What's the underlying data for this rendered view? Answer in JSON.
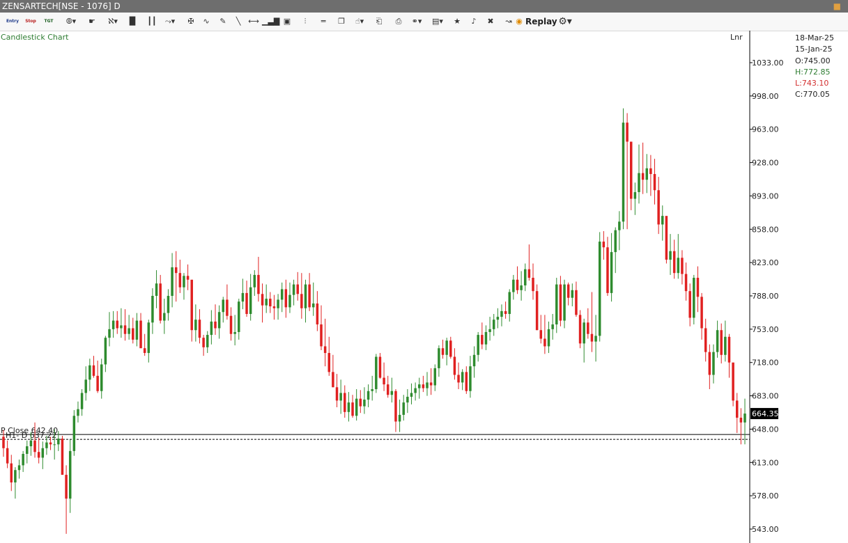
{
  "window": {
    "title": "ZENSARTECH[NSE - 1076] D",
    "close_glyph": "💰"
  },
  "toolbar": {
    "items": [
      {
        "name": "entry-tool",
        "label": "Entry",
        "kind": "small",
        "color": "#1e3a8a"
      },
      {
        "name": "stop-tool",
        "label": "Stop",
        "kind": "small",
        "color": "#b71c1c"
      },
      {
        "name": "target-tool",
        "label": "TGT",
        "kind": "small",
        "color": "#1b5e20"
      },
      {
        "name": "indicator-icon",
        "label": "⦾▾"
      },
      {
        "name": "cursor-icon",
        "label": "☛"
      },
      {
        "name": "study-icon",
        "label": "ℵ▾"
      },
      {
        "name": "bar-chart-icon",
        "label": "▐▌"
      },
      {
        "name": "candle-chart-icon",
        "label": "┃┃"
      },
      {
        "name": "pattern-icon",
        "label": "⤳▾"
      },
      {
        "name": "crosshair-icon",
        "label": "✠"
      },
      {
        "name": "wave-icon",
        "label": "∿"
      },
      {
        "name": "pencil-icon",
        "label": "✎"
      },
      {
        "name": "trendline-icon",
        "label": "╲"
      },
      {
        "name": "horizontal-line-icon",
        "label": "⟷"
      },
      {
        "name": "volume-icon",
        "label": "▁▃▇"
      },
      {
        "name": "box-icon",
        "label": "▣"
      },
      {
        "name": "fib-icon",
        "label": "⫶"
      },
      {
        "name": "equal-lines-icon",
        "label": "═"
      },
      {
        "name": "tag-icon",
        "label": "❐"
      },
      {
        "name": "hand-icon",
        "label": "☝▾"
      },
      {
        "name": "doc-chart-icon",
        "label": "⎗"
      },
      {
        "name": "settings-doc-icon",
        "label": "⎙"
      },
      {
        "name": "link-icon",
        "label": "⚭▾"
      },
      {
        "name": "layout-icon",
        "label": "▤▾"
      },
      {
        "name": "star-icon",
        "label": "★"
      },
      {
        "name": "alert-icon",
        "label": "♪"
      },
      {
        "name": "delete-icon",
        "label": "✖"
      },
      {
        "name": "compare-icon",
        "label": "↝"
      }
    ],
    "replay_label": "Replay",
    "gear_glyph": "⚙▾"
  },
  "chart_data": {
    "type": "candlestick",
    "title": "Candlestick Chart",
    "scale_mode": "Lnr",
    "ylim": [
      533,
      1055
    ],
    "y_ticks": [
      "1033.00",
      "998.00",
      "963.00",
      "928.00",
      "893.00",
      "858.00",
      "823.00",
      "788.00",
      "753.00",
      "718.00",
      "683.00",
      "648.00",
      "613.00",
      "578.00",
      "543.00"
    ],
    "last_price": "664.35",
    "last_price_value": 664.35,
    "up_color": "#2e8b2e",
    "down_color": "#e02020",
    "info": {
      "date1": "18-Mar-25",
      "date2": "15-Jan-25",
      "open": "O:745.00",
      "high": "H:772.85",
      "low": "L:743.10",
      "close": "C:770.05"
    },
    "hlines": [
      {
        "label": "H1- D  637.22",
        "value": 637.22,
        "style": "dashed"
      },
      {
        "label": "P Close 642.40",
        "value": 642.4,
        "style": "solid"
      }
    ],
    "candles": [
      [
        640,
        647,
        619,
        628
      ],
      [
        628,
        636,
        607,
        612
      ],
      [
        612,
        621,
        583,
        592
      ],
      [
        592,
        608,
        575,
        605
      ],
      [
        605,
        616,
        596,
        610
      ],
      [
        610,
        625,
        603,
        622
      ],
      [
        622,
        636,
        612,
        630
      ],
      [
        630,
        645,
        620,
        636
      ],
      [
        636,
        655,
        618,
        624
      ],
      [
        624,
        639,
        612,
        618
      ],
      [
        618,
        635,
        606,
        628
      ],
      [
        628,
        641,
        621,
        634
      ],
      [
        634,
        640,
        626,
        632
      ],
      [
        632,
        648,
        616,
        632
      ],
      [
        632,
        646,
        625,
        638
      ],
      [
        638,
        641,
        600,
        600
      ],
      [
        600,
        610,
        538,
        575
      ],
      [
        575,
        637,
        560,
        625
      ],
      [
        625,
        668,
        620,
        662
      ],
      [
        662,
        677,
        655,
        669
      ],
      [
        669,
        690,
        662,
        686
      ],
      [
        686,
        714,
        678,
        700
      ],
      [
        700,
        722,
        688,
        715
      ],
      [
        715,
        725,
        702,
        704
      ],
      [
        704,
        720,
        686,
        688
      ],
      [
        688,
        722,
        680,
        716
      ],
      [
        716,
        746,
        708,
        744
      ],
      [
        744,
        771,
        735,
        753
      ],
      [
        753,
        772,
        744,
        762
      ],
      [
        762,
        772,
        748,
        754
      ],
      [
        754,
        775,
        744,
        757
      ],
      [
        757,
        774,
        741,
        748
      ],
      [
        748,
        768,
        742,
        754
      ],
      [
        754,
        765,
        738,
        742
      ],
      [
        742,
        770,
        735,
        762
      ],
      [
        762,
        770,
        734,
        733
      ],
      [
        733,
        748,
        725,
        728
      ],
      [
        728,
        763,
        718,
        760
      ],
      [
        760,
        796,
        748,
        788
      ],
      [
        788,
        815,
        775,
        801
      ],
      [
        801,
        810,
        759,
        762
      ],
      [
        762,
        785,
        748,
        770
      ],
      [
        770,
        795,
        762,
        788
      ],
      [
        788,
        833,
        776,
        818
      ],
      [
        818,
        835,
        782,
        812
      ],
      [
        812,
        826,
        791,
        797
      ],
      [
        797,
        812,
        784,
        809
      ],
      [
        809,
        821,
        794,
        805
      ],
      [
        805,
        768,
        740,
        752
      ],
      [
        752,
        779,
        740,
        763
      ],
      [
        763,
        774,
        738,
        744
      ],
      [
        744,
        747,
        725,
        734
      ],
      [
        734,
        751,
        728,
        747
      ],
      [
        747,
        773,
        737,
        761
      ],
      [
        761,
        779,
        747,
        754
      ],
      [
        754,
        778,
        743,
        771
      ],
      [
        771,
        787,
        760,
        784
      ],
      [
        784,
        800,
        763,
        767
      ],
      [
        767,
        776,
        741,
        748
      ],
      [
        748,
        768,
        736,
        750
      ],
      [
        750,
        785,
        742,
        782
      ],
      [
        782,
        806,
        774,
        791
      ],
      [
        791,
        804,
        766,
        769
      ],
      [
        769,
        811,
        762,
        797
      ],
      [
        797,
        815,
        788,
        810
      ],
      [
        810,
        829,
        782,
        790
      ],
      [
        790,
        801,
        760,
        778
      ],
      [
        778,
        800,
        770,
        785
      ],
      [
        785,
        792,
        770,
        777
      ],
      [
        777,
        789,
        763,
        775
      ],
      [
        775,
        790,
        763,
        784
      ],
      [
        784,
        802,
        771,
        795
      ],
      [
        795,
        805,
        765,
        776
      ],
      [
        776,
        802,
        770,
        789
      ],
      [
        789,
        805,
        778,
        800
      ],
      [
        800,
        813,
        783,
        790
      ],
      [
        790,
        812,
        764,
        775
      ],
      [
        775,
        805,
        760,
        800
      ],
      [
        800,
        812,
        772,
        776
      ],
      [
        776,
        802,
        767,
        780
      ],
      [
        780,
        793,
        751,
        758
      ],
      [
        758,
        778,
        731,
        735
      ],
      [
        735,
        764,
        714,
        728
      ],
      [
        728,
        745,
        704,
        708
      ],
      [
        708,
        726,
        692,
        692
      ],
      [
        692,
        706,
        671,
        678
      ],
      [
        678,
        700,
        664,
        686
      ],
      [
        686,
        694,
        660,
        666
      ],
      [
        666,
        687,
        656,
        676
      ],
      [
        676,
        684,
        660,
        662
      ],
      [
        662,
        690,
        657,
        680
      ],
      [
        680,
        689,
        665,
        672
      ],
      [
        672,
        692,
        664,
        679
      ],
      [
        679,
        695,
        671,
        688
      ],
      [
        688,
        704,
        678,
        690
      ],
      [
        690,
        727,
        686,
        724
      ],
      [
        724,
        728,
        701,
        702
      ],
      [
        702,
        718,
        688,
        695
      ],
      [
        695,
        704,
        681,
        684
      ],
      [
        684,
        702,
        676,
        688
      ],
      [
        688,
        690,
        645,
        656
      ],
      [
        656,
        679,
        645,
        663
      ],
      [
        663,
        684,
        657,
        676
      ],
      [
        676,
        690,
        665,
        682
      ],
      [
        682,
        696,
        674,
        686
      ],
      [
        686,
        697,
        678,
        691
      ],
      [
        691,
        702,
        680,
        695
      ],
      [
        695,
        704,
        687,
        691
      ],
      [
        691,
        708,
        683,
        697
      ],
      [
        697,
        712,
        684,
        694
      ],
      [
        694,
        716,
        688,
        712
      ],
      [
        712,
        736,
        703,
        733
      ],
      [
        733,
        742,
        722,
        726
      ],
      [
        726,
        744,
        715,
        741
      ],
      [
        741,
        745,
        722,
        724
      ],
      [
        724,
        733,
        700,
        705
      ],
      [
        705,
        718,
        690,
        697
      ],
      [
        697,
        711,
        689,
        708
      ],
      [
        708,
        714,
        685,
        688
      ],
      [
        688,
        725,
        681,
        714
      ],
      [
        714,
        735,
        702,
        726
      ],
      [
        726,
        750,
        719,
        747
      ],
      [
        747,
        760,
        732,
        737
      ],
      [
        737,
        757,
        731,
        750
      ],
      [
        750,
        766,
        741,
        753
      ],
      [
        753,
        769,
        746,
        763
      ],
      [
        763,
        775,
        754,
        766
      ],
      [
        766,
        779,
        756,
        772
      ],
      [
        772,
        782,
        764,
        769
      ],
      [
        769,
        795,
        761,
        792
      ],
      [
        792,
        810,
        784,
        805
      ],
      [
        805,
        819,
        790,
        794
      ],
      [
        794,
        814,
        783,
        799
      ],
      [
        799,
        822,
        793,
        816
      ],
      [
        816,
        842,
        804,
        807
      ],
      [
        807,
        822,
        784,
        793
      ],
      [
        793,
        800,
        752,
        752
      ],
      [
        752,
        768,
        738,
        743
      ],
      [
        743,
        768,
        727,
        735
      ],
      [
        735,
        761,
        728,
        753
      ],
      [
        753,
        769,
        742,
        758
      ],
      [
        758,
        807,
        749,
        800
      ],
      [
        800,
        809,
        756,
        762
      ],
      [
        762,
        805,
        754,
        800
      ],
      [
        800,
        802,
        778,
        786
      ],
      [
        786,
        801,
        777,
        794
      ],
      [
        794,
        803,
        766,
        768
      ],
      [
        768,
        773,
        733,
        738
      ],
      [
        738,
        764,
        718,
        760
      ],
      [
        760,
        775,
        743,
        748
      ],
      [
        748,
        792,
        729,
        740
      ],
      [
        740,
        768,
        719,
        746
      ],
      [
        746,
        855,
        740,
        845
      ],
      [
        845,
        856,
        826,
        839
      ],
      [
        839,
        850,
        788,
        791
      ],
      [
        791,
        854,
        782,
        834
      ],
      [
        834,
        860,
        812,
        857
      ],
      [
        857,
        877,
        836,
        866
      ],
      [
        866,
        985,
        858,
        970
      ],
      [
        970,
        980,
        858,
        950
      ],
      [
        950,
        921,
        878,
        890
      ],
      [
        890,
        907,
        873,
        897
      ],
      [
        897,
        947,
        885,
        917
      ],
      [
        917,
        949,
        895,
        910
      ],
      [
        910,
        937,
        896,
        922
      ],
      [
        922,
        936,
        893,
        916
      ],
      [
        916,
        932,
        884,
        899
      ],
      [
        899,
        913,
        853,
        863
      ],
      [
        863,
        883,
        846,
        872
      ],
      [
        872,
        871,
        822,
        826
      ],
      [
        826,
        853,
        810,
        835
      ],
      [
        835,
        847,
        806,
        812
      ],
      [
        812,
        853,
        806,
        828
      ],
      [
        828,
        836,
        800,
        811
      ],
      [
        811,
        823,
        783,
        793
      ],
      [
        793,
        801,
        756,
        765
      ],
      [
        765,
        810,
        758,
        807
      ],
      [
        807,
        819,
        771,
        787
      ],
      [
        787,
        791,
        742,
        754
      ],
      [
        754,
        764,
        719,
        729
      ],
      [
        729,
        737,
        690,
        705
      ],
      [
        705,
        737,
        696,
        729
      ],
      [
        729,
        762,
        723,
        752
      ],
      [
        752,
        759,
        717,
        726
      ],
      [
        726,
        762,
        719,
        745
      ],
      [
        745,
        748,
        702,
        718
      ],
      [
        718,
        701,
        672,
        678
      ],
      [
        678,
        686,
        644,
        660
      ],
      [
        660,
        670,
        632,
        655
      ],
      [
        655,
        680,
        632,
        664.35
      ]
    ]
  }
}
